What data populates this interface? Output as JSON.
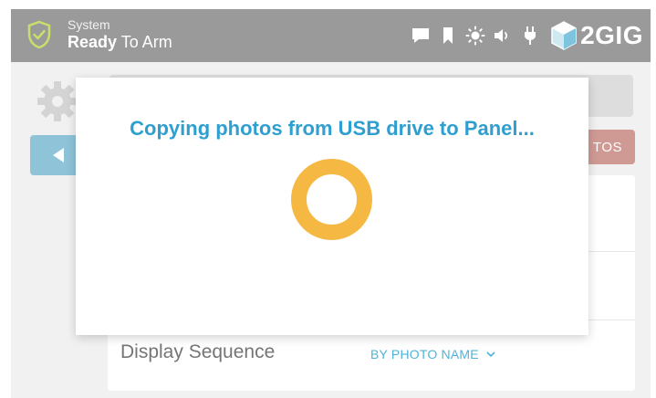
{
  "status": {
    "system_label": "System",
    "state_bold": "Ready",
    "state_rest": " To Arm"
  },
  "header_icons": [
    "message-icon",
    "bookmark-icon",
    "brightness-icon",
    "volume-icon",
    "power-plug-icon"
  ],
  "brand": {
    "name": "2GIG"
  },
  "background_page": {
    "photos_button_fragment": "TOS",
    "display_sequence_label": "Display Sequence",
    "display_sequence_value": "BY PHOTO NAME"
  },
  "dialog": {
    "message": "Copying photos from USB drive to Panel..."
  },
  "colors": {
    "statusbar": "#9a9a9a",
    "accent_blue": "#2f9fd0",
    "spinner": "#f5b843",
    "shield_green": "#c8e06a"
  }
}
